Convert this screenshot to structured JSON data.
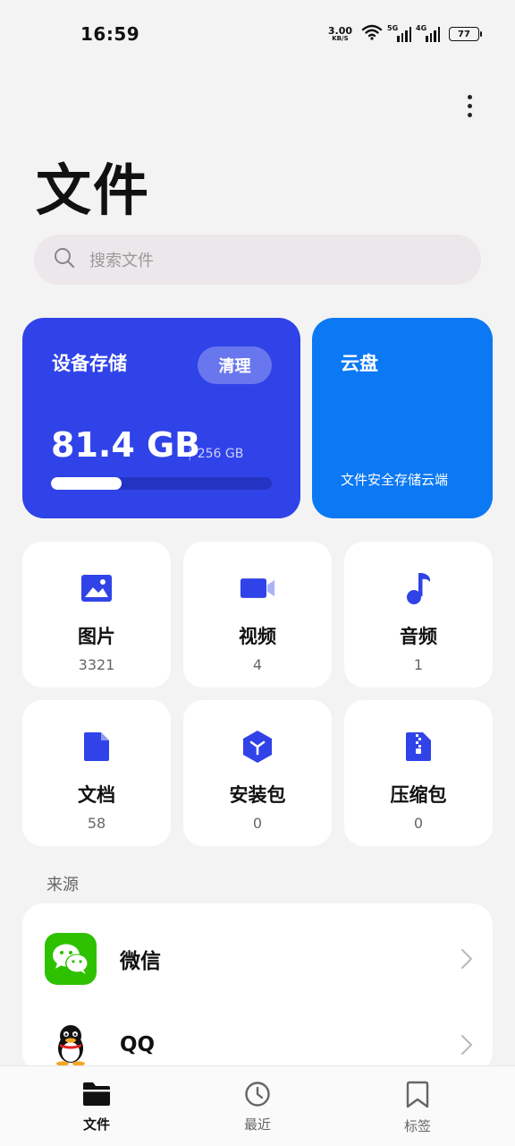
{
  "status_bar": {
    "time": "16:59",
    "speed_value": "3.00",
    "speed_unit": "KB/S",
    "sim1_label": "5G",
    "sim2_label": "4G",
    "battery": "77"
  },
  "page": {
    "title": "文件",
    "more_icon": "more-vertical-icon"
  },
  "search": {
    "placeholder": "搜索文件"
  },
  "storage": {
    "device_label": "设备存储",
    "clean_label": "清理",
    "used": "81.4 GB",
    "total": "256 GB",
    "used_fraction": 0.318,
    "cloud_label": "云盘",
    "cloud_desc": "文件安全存储云端"
  },
  "categories": [
    {
      "name": "图片",
      "count": "3321",
      "icon": "image-icon"
    },
    {
      "name": "视频",
      "count": "4",
      "icon": "video-icon"
    },
    {
      "name": "音频",
      "count": "1",
      "icon": "music-note-icon"
    },
    {
      "name": "文档",
      "count": "58",
      "icon": "document-icon"
    },
    {
      "name": "安装包",
      "count": "0",
      "icon": "package-icon"
    },
    {
      "name": "压缩包",
      "count": "0",
      "icon": "zip-icon"
    }
  ],
  "sources": {
    "label": "来源",
    "items": [
      {
        "name": "微信",
        "icon": "wechat-icon"
      },
      {
        "name": "QQ",
        "icon": "qq-icon"
      }
    ]
  },
  "bottom_nav": [
    {
      "label": "文件",
      "icon": "folder-icon",
      "active": true
    },
    {
      "label": "最近",
      "icon": "clock-icon",
      "active": false
    },
    {
      "label": "标签",
      "icon": "bookmark-icon",
      "active": false
    }
  ],
  "colors": {
    "primary_blue": "#3043e8",
    "cloud_blue": "#0b78f4",
    "wechat_green": "#2dc100",
    "background": "#f3f3f3"
  }
}
